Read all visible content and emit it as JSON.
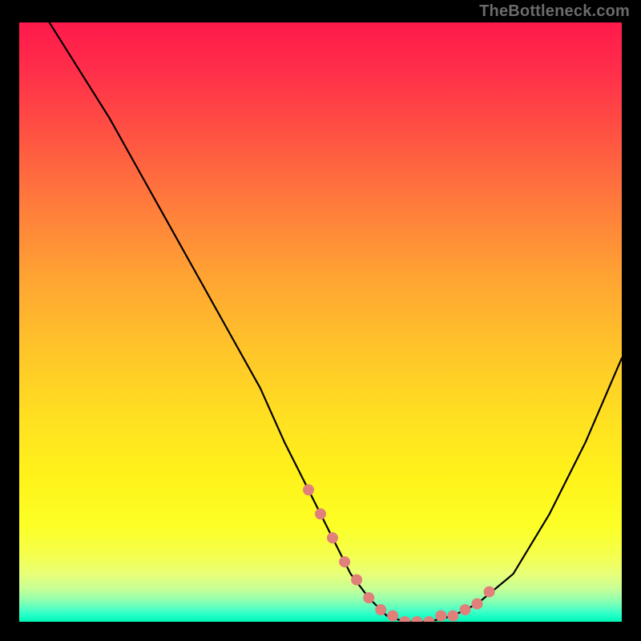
{
  "attribution": "TheBottleneck.com",
  "chart_data": {
    "type": "line",
    "title": "",
    "xlabel": "",
    "ylabel": "",
    "xlim": [
      0,
      100
    ],
    "ylim": [
      0,
      100
    ],
    "series": [
      {
        "name": "bottleneck-curve",
        "x": [
          5,
          10,
          15,
          20,
          25,
          30,
          35,
          40,
          44,
          48,
          52,
          55,
          58,
          61,
          64,
          68,
          72,
          76,
          82,
          88,
          94,
          100
        ],
        "y": [
          100,
          92,
          84,
          75,
          66,
          57,
          48,
          39,
          30,
          22,
          14,
          8,
          4,
          1,
          0,
          0,
          1,
          3,
          8,
          18,
          30,
          44
        ]
      }
    ],
    "markers": {
      "name": "highlight-dots",
      "color": "#e17f7b",
      "x": [
        48,
        50,
        52,
        54,
        56,
        58,
        60,
        62,
        64,
        66,
        68,
        70,
        72,
        74,
        76,
        78
      ],
      "y": [
        22,
        18,
        14,
        10,
        7,
        4,
        2,
        1,
        0,
        0,
        0,
        1,
        1,
        2,
        3,
        5
      ]
    },
    "gradient_stops": [
      {
        "pos": 0,
        "color": "#ff1a4b"
      },
      {
        "pos": 50,
        "color": "#ffc32a"
      },
      {
        "pos": 85,
        "color": "#fcff26"
      },
      {
        "pos": 100,
        "color": "#00f7b4"
      }
    ]
  }
}
